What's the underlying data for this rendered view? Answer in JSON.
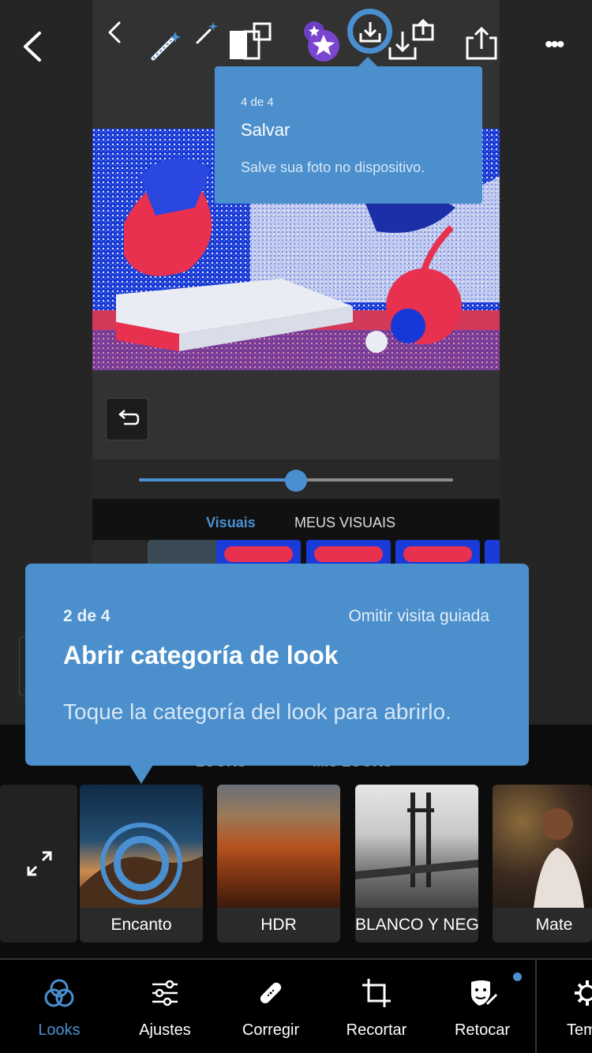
{
  "colors": {
    "accent": "#4a8fd0",
    "tooltip": "#4b8fcc",
    "background": "#1e1e1e"
  },
  "toolbar": {
    "icons": [
      "back-icon",
      "chevron-left-icon",
      "magic-wand-icon",
      "magic-wand-small-icon",
      "compare-icon",
      "premium-star-icon",
      "save-icon",
      "export-icon",
      "share-icon",
      "more-icon"
    ]
  },
  "tooltip_save": {
    "step": "4 de 4",
    "title": "Salvar",
    "body": "Salve sua foto no dispositivo."
  },
  "slider": {
    "value_fraction": 0.5
  },
  "inner_tabs": {
    "visuals": "Visuais",
    "my_visuals": "MEUS VISUAIS"
  },
  "tooltip_looks": {
    "step": "2 de 4",
    "skip": "Omitir visita guiada",
    "title": "Abrir categoría de look",
    "body": "Toque la categoría del look para abrirlo."
  },
  "band_tabs": {
    "looks": "LOOKS",
    "my_looks": "MIS LOOKS"
  },
  "looks": [
    {
      "label": "Encanto"
    },
    {
      "label": "HDR"
    },
    {
      "label": "BLANCO Y NEGRO"
    },
    {
      "label": "Mate"
    }
  ],
  "nav": [
    {
      "label": "Looks",
      "icon": "looks-icon",
      "active": true
    },
    {
      "label": "Ajustes",
      "icon": "sliders-icon"
    },
    {
      "label": "Corregir",
      "icon": "bandage-icon"
    },
    {
      "label": "Recortar",
      "icon": "crop-icon"
    },
    {
      "label": "Retocar",
      "icon": "retouch-icon"
    },
    {
      "label": "Temas",
      "icon": "themes-icon"
    }
  ]
}
